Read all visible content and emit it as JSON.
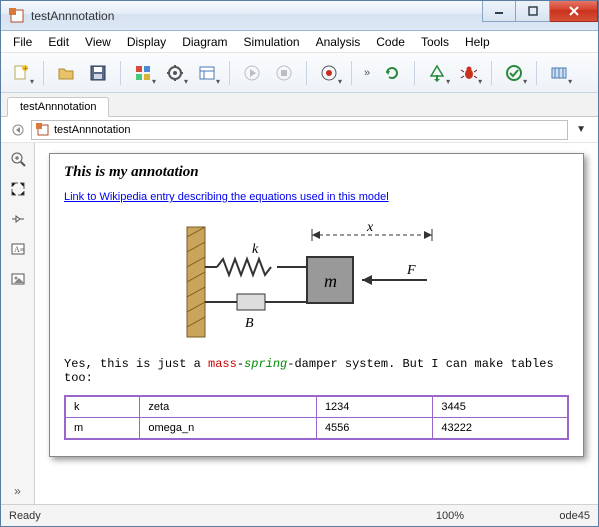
{
  "window": {
    "title": "testAnnnotation"
  },
  "menu": [
    "File",
    "Edit",
    "View",
    "Display",
    "Diagram",
    "Simulation",
    "Analysis",
    "Code",
    "Tools",
    "Help"
  ],
  "tabs": [
    "testAnnnotation"
  ],
  "breadcrumb": {
    "path": "testAnnnotation"
  },
  "annotation": {
    "title": "This is my annotation",
    "link_text": "Link to Wikipedia  entry describing the equations used in this model",
    "body_prefix": "Yes, this is just a ",
    "body_mass": "mass",
    "body_dash": "-",
    "body_spring": "spring",
    "body_suffix": "-damper system. But I can make tables too:",
    "diagram_labels": {
      "x": "x",
      "k": "k",
      "m": "m",
      "F": "F",
      "B": "B"
    },
    "table": [
      [
        "k",
        "zeta",
        "1234",
        "3445"
      ],
      [
        "m",
        "omega_n",
        "4556",
        "43222"
      ]
    ]
  },
  "status": {
    "left": "Ready",
    "zoom": "100%",
    "solver": "ode45"
  },
  "toolbar_icons": {
    "new": "new-icon",
    "open": "open-icon",
    "save": "save-icon",
    "library": "library-browser-icon",
    "config": "model-config-icon",
    "explorer": "model-explorer-icon",
    "run": "run-icon",
    "stop": "stop-icon",
    "record": "record-icon",
    "update": "update-diagram-icon",
    "build": "build-icon",
    "debug": "debug-icon",
    "check": "advisor-icon",
    "more": "more-icon"
  },
  "left_icons": [
    "zoom-in-icon",
    "fit-to-view-icon",
    "normal-view-icon",
    "annotation-tool-icon",
    "image-tool-icon"
  ]
}
